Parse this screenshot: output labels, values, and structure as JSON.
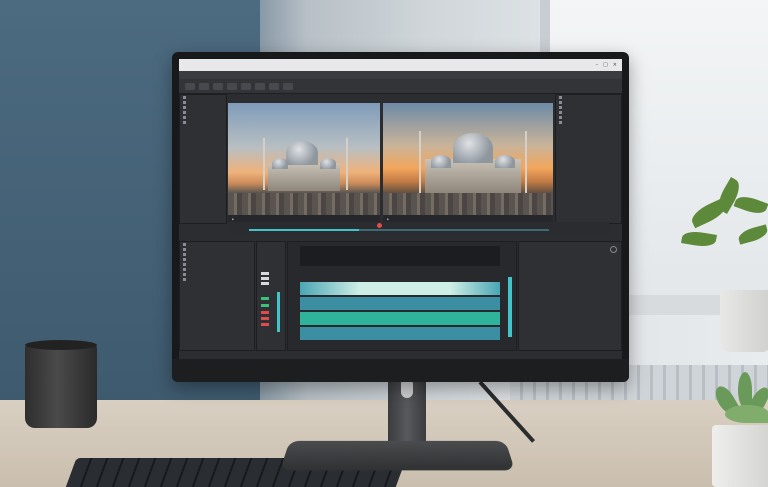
{
  "app": {
    "window_title": "",
    "menu": [
      "",
      "",
      "",
      "",
      "",
      "",
      "",
      "",
      "",
      ""
    ],
    "source_panel": {
      "items": [
        "",
        "",
        "",
        "",
        "",
        ""
      ]
    },
    "browser_panel": {
      "items": [
        "",
        "",
        "",
        "",
        "",
        "",
        "",
        "",
        ""
      ]
    },
    "effects_panel": {
      "items": [
        "",
        "",
        "",
        "",
        "",
        "",
        "",
        ""
      ]
    }
  },
  "colors": {
    "accent_teal": "#41c3c9",
    "clip_green": "#2fb39a",
    "clip_light": "#cfeee6",
    "playhead_red": "#e04b4b",
    "knob_blue": "#2f8fe8",
    "knob_orange": "#f0a54a"
  },
  "icons": [
    "close-icon",
    "maximize-icon",
    "minimize-icon",
    "play-icon",
    "gear-icon",
    "folder-icon"
  ]
}
